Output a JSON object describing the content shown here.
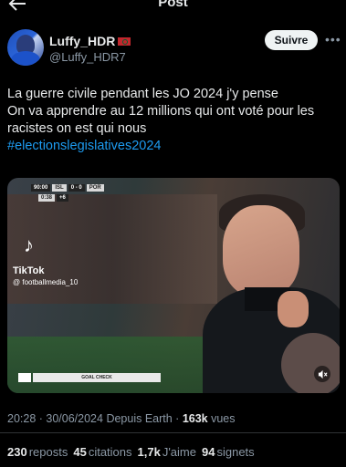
{
  "header": {
    "title": "Post"
  },
  "author": {
    "display_name": "Luffy_HDR",
    "handle": "@Luffy_HDR7"
  },
  "follow_label": "Suivre",
  "tweet": {
    "line1": "La guerre civile pendant les JO 2024 j'y pense",
    "line2": "On va apprendre au 12 millions qui ont voté pour les",
    "line3": "racistes on est qui nous",
    "hashtag": "#electionslegislatives2024"
  },
  "video": {
    "score_time": "90:00",
    "team_home": "ISL",
    "score": "0 - 0",
    "team_away": "POR",
    "added_time": "0:38",
    "added_plus": "+6",
    "tiktok_brand": "TikTok",
    "tiktok_user": "@ footballmedia_10",
    "goal_check": "GOAL CHECK"
  },
  "meta": {
    "time": "20:28",
    "date": "30/06/2024",
    "source": "Depuis Earth",
    "views_count": "163k",
    "views_label": "vues"
  },
  "stats": {
    "reposts_count": "230",
    "reposts_label": "reposts",
    "citations_count": "45",
    "citations_label": "citations",
    "likes_count": "1,7k",
    "likes_label": "J'aime",
    "bookmarks_count": "94",
    "bookmarks_label": "signets"
  },
  "colors": {
    "accent": "#1d9bf0",
    "background": "#000000",
    "secondary_text": "#8b98a5"
  }
}
